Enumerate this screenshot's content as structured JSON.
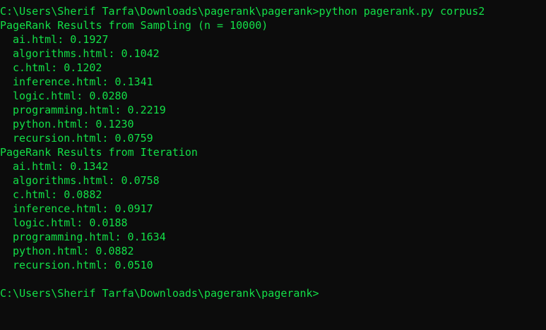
{
  "terminal": {
    "command_line": "C:\\Users\\Sherif Tarfa\\Downloads\\pagerank\\pagerank>python pagerank.py corpus2",
    "sampling": {
      "header": "PageRank Results from Sampling (n = 10000)",
      "results": [
        "ai.html: 0.1927",
        "algorithms.html: 0.1042",
        "c.html: 0.1202",
        "inference.html: 0.1341",
        "logic.html: 0.0280",
        "programming.html: 0.2219",
        "python.html: 0.1230",
        "recursion.html: 0.0759"
      ]
    },
    "iteration": {
      "header": "PageRank Results from Iteration",
      "results": [
        "ai.html: 0.1342",
        "algorithms.html: 0.0758",
        "c.html: 0.0882",
        "inference.html: 0.0917",
        "logic.html: 0.0188",
        "programming.html: 0.1634",
        "python.html: 0.0882",
        "recursion.html: 0.0510"
      ]
    },
    "prompt_line": "C:\\Users\\Sherif Tarfa\\Downloads\\pagerank\\pagerank>",
    "colors": {
      "background": "#0c0c0c",
      "text": "#13e048"
    }
  }
}
